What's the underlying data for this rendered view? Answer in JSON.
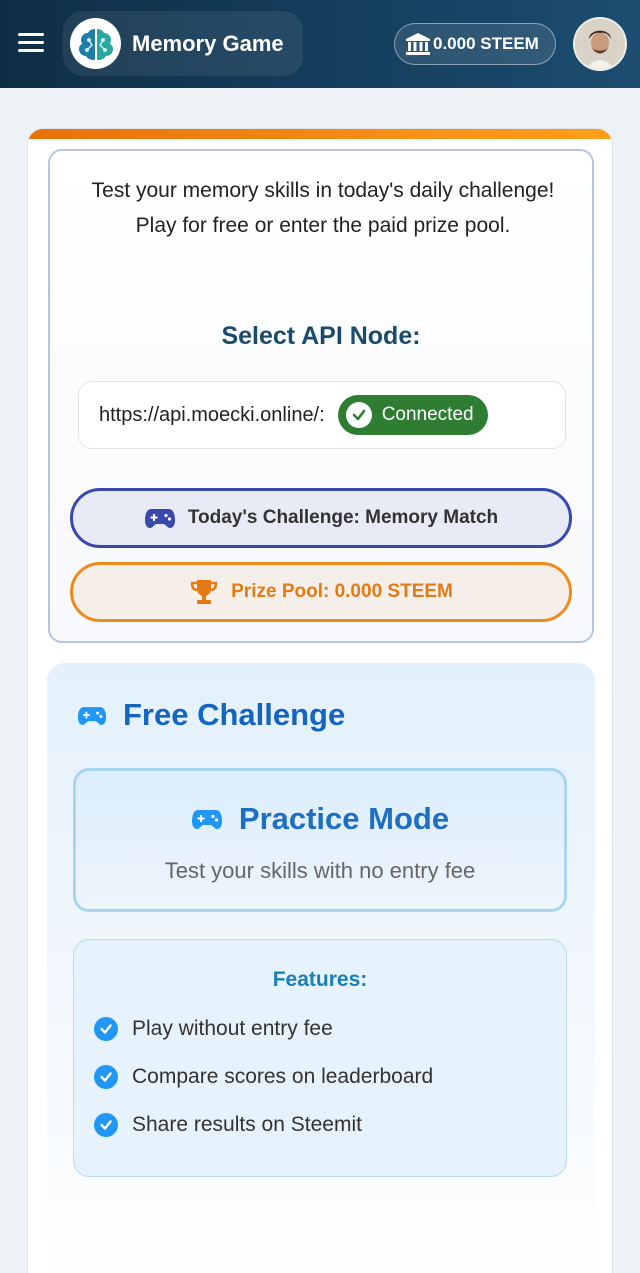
{
  "header": {
    "title": "Memory Game",
    "balance": "0.000 STEEM",
    "menu_icon": "hamburger-menu-icon",
    "logo_icon": "brain-icon",
    "balance_icon": "bank-icon"
  },
  "intro": {
    "text": "Test your memory skills in today's daily challenge! Play for free or enter the paid prize pool.",
    "api_label": "Select API Node:",
    "api_url": "https://api.moecki.online/:",
    "status": "Connected",
    "challenge": "Today's Challenge: Memory Match",
    "prize": "Prize Pool: 0.000 STEEM"
  },
  "free": {
    "title": "Free Challenge",
    "practice_title": "Practice Mode",
    "practice_subtitle": "Test your skills with no entry fee",
    "features_title": "Features:",
    "features": [
      "Play without entry fee",
      "Compare scores on leaderboard",
      "Share results on Steemit"
    ]
  },
  "colors": {
    "header": "#153d5c",
    "accent_orange": "#ef8a1e",
    "indigo": "#3949ab",
    "blue": "#1565c0",
    "success": "#2e7d32"
  }
}
